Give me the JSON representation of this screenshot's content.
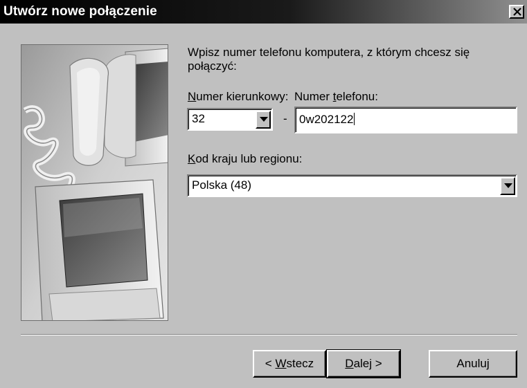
{
  "window": {
    "title": "Utwórz nowe połączenie"
  },
  "instruction": "Wpisz numer telefonu komputera, z którym chcesz się połączyć:",
  "fields": {
    "area_code_label_mnemonic": "N",
    "area_code_label_rest": "umer kierunkowy:",
    "phone_label_pre": "Numer ",
    "phone_label_mnemonic": "t",
    "phone_label_rest": "elefonu:",
    "area_code_value": "32",
    "separator_dash": "-",
    "phone_value": "0w202122",
    "country_label_mnemonic": "K",
    "country_label_rest": "od kraju lub regionu:",
    "country_value": "Polska (48)"
  },
  "buttons": {
    "back_pre": "< ",
    "back_mnemonic": "W",
    "back_rest": "stecz",
    "next_mnemonic": "D",
    "next_rest": "alej >",
    "cancel": "Anuluj"
  },
  "icons": {
    "close": "close-icon",
    "dropdown": "chevron-down-icon"
  },
  "colors": {
    "dialog_face": "#c0c0c0",
    "titlebar_start": "#000000",
    "titlebar_end": "#909090",
    "field_background": "#ffffff"
  }
}
